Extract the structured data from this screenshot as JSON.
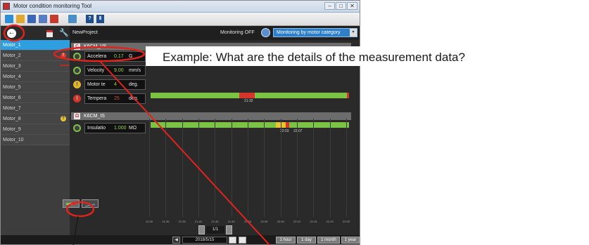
{
  "window": {
    "title": "Motor condition monitoring Tool",
    "controls": [
      "–",
      "□",
      "✕"
    ]
  },
  "toolbar": {
    "help_labels": [
      "?",
      "Ⅱ"
    ]
  },
  "header": {
    "project": "NewProject",
    "monitoring": "Monitoring OFF",
    "mode_select": "Monitoring by motor category",
    "caret": "▾"
  },
  "sidebar": {
    "back": "←",
    "motors": [
      {
        "label": "Motor_1",
        "badge": ""
      },
      {
        "label": "Motor_2",
        "badge": "!"
      },
      {
        "label": "Motor_3",
        "badge": ""
      },
      {
        "label": "Motor_4",
        "badge": ""
      },
      {
        "label": "Motor_5",
        "badge": ""
      },
      {
        "label": "Motor_6",
        "badge": ""
      },
      {
        "label": "Motor_7",
        "badge": ""
      },
      {
        "label": "Motor_8",
        "badge": "?"
      },
      {
        "label": "Motor_9",
        "badge": ""
      },
      {
        "label": "Motor_10",
        "badge": ""
      }
    ]
  },
  "groups": [
    {
      "name": "K6CM_V8",
      "icon": "C",
      "rows": [
        {
          "status": "ok",
          "name": "Accelera",
          "value": "0.17",
          "unit": "G"
        },
        {
          "status": "ok",
          "name": "Velocity",
          "value": "9.00",
          "unit": "mm/s"
        },
        {
          "status": "warn",
          "name": "Motor te",
          "value": "4",
          "unit": "deg."
        },
        {
          "status": "alarm",
          "name": "Tempera",
          "value": "25",
          "unit": "deg."
        }
      ],
      "bar_labels": [
        "21:32"
      ]
    },
    {
      "name": "K6CM_IS",
      "icon": "Ω",
      "rows": [
        {
          "status": "ok",
          "name": "Insulatio",
          "value": "1.000",
          "unit": "MΩ"
        }
      ],
      "bar_labels": [
        "22:03",
        "22:07"
      ]
    }
  ],
  "status_icons": {
    "ok": "",
    "warn": "!",
    "alarm": "!"
  },
  "time_axis": [
    "21:25",
    "21:30",
    "21:35",
    "21:40",
    "21:45",
    "21:50",
    "21:55",
    "22:00",
    "22:05",
    "22:10",
    "22:15",
    "22:20",
    "22:25"
  ],
  "pager": {
    "value": "1/1",
    "prev": "‹",
    "next": "›"
  },
  "footer": {
    "prev": "◀",
    "date": "2018/5/15",
    "ranges": [
      "1 hour",
      "1 day",
      "1 month",
      "1 year"
    ]
  },
  "callout": {
    "text": "Example: What are the details of the measurement data?"
  },
  "colors": {
    "accent": "#2d9fe0",
    "ok": "#7cc243",
    "warn": "#e7c630",
    "alarm": "#d6362a",
    "annotation": "#e0231c"
  }
}
